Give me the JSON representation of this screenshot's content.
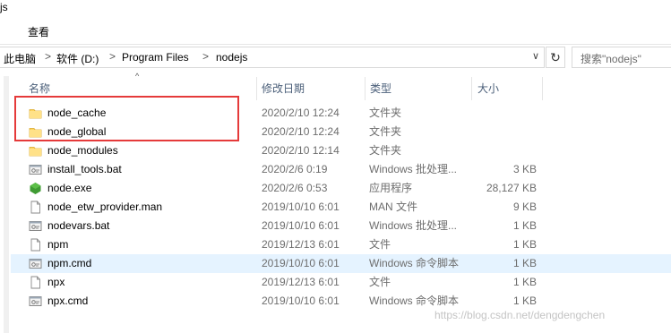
{
  "window": {
    "title_fragment": "js"
  },
  "ribbon": {
    "tab_view": "查看"
  },
  "address": {
    "crumbs": [
      "此电脑",
      "软件 (D:)",
      "Program Files",
      "nodejs"
    ],
    "separator": ">"
  },
  "search": {
    "placeholder": "搜索\"nodejs\""
  },
  "columns": {
    "name": "名称",
    "date": "修改日期",
    "type": "类型",
    "size": "大小"
  },
  "files": [
    {
      "icon": "folder-icon",
      "name": "node_cache",
      "date": "2020/2/10 12:24",
      "type": "文件夹",
      "size": ""
    },
    {
      "icon": "folder-icon",
      "name": "node_global",
      "date": "2020/2/10 12:24",
      "type": "文件夹",
      "size": ""
    },
    {
      "icon": "folder-icon",
      "name": "node_modules",
      "date": "2020/2/10 12:14",
      "type": "文件夹",
      "size": ""
    },
    {
      "icon": "batch-file-icon",
      "name": "install_tools.bat",
      "date": "2020/2/6 0:19",
      "type": "Windows 批处理...",
      "size": "3 KB"
    },
    {
      "icon": "node-exe-icon",
      "name": "node.exe",
      "date": "2020/2/6 0:53",
      "type": "应用程序",
      "size": "28,127 KB"
    },
    {
      "icon": "document-icon",
      "name": "node_etw_provider.man",
      "date": "2019/10/10 6:01",
      "type": "MAN 文件",
      "size": "9 KB"
    },
    {
      "icon": "batch-file-icon",
      "name": "nodevars.bat",
      "date": "2019/10/10 6:01",
      "type": "Windows 批处理...",
      "size": "1 KB"
    },
    {
      "icon": "document-icon",
      "name": "npm",
      "date": "2019/12/13 6:01",
      "type": "文件",
      "size": "1 KB"
    },
    {
      "icon": "batch-file-icon",
      "name": "npm.cmd",
      "date": "2019/10/10 6:01",
      "type": "Windows 命令脚本",
      "size": "1 KB"
    },
    {
      "icon": "document-icon",
      "name": "npx",
      "date": "2019/12/13 6:01",
      "type": "文件",
      "size": "1 KB"
    },
    {
      "icon": "batch-file-icon",
      "name": "npx.cmd",
      "date": "2019/10/10 6:01",
      "type": "Windows 命令脚本",
      "size": "1 KB"
    }
  ],
  "selected_row": "npm.cmd",
  "highlight_color": "#e53a3a",
  "watermark": "https://blog.csdn.net/dengdengchen"
}
